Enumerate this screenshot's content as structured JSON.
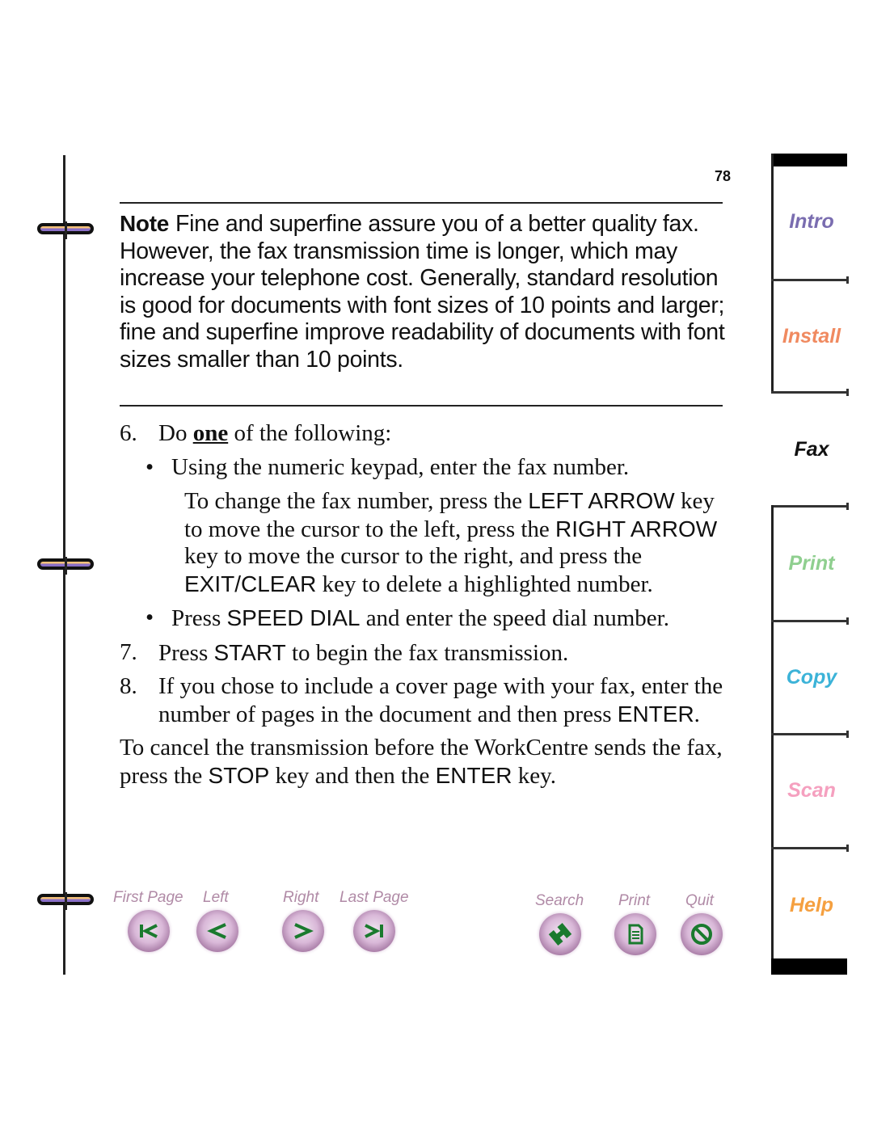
{
  "page_number": "78",
  "note": {
    "label": "Note",
    "text": "Fine and superfine assure you of a better quality fax. However, the fax transmission time is longer, which may increase your telephone cost. Generally, standard resolution is good for documents with font sizes of 10 points and larger; fine and superfine improve readability of documents with font sizes smaller than 10 points."
  },
  "steps": {
    "s6": {
      "num": "6.",
      "pre": "Do ",
      "emph": "one",
      "post": " of the following:"
    },
    "b1": {
      "text": "Using the numeric keypad, enter the fax number."
    },
    "b1sub": {
      "t1": "To change the fax number, press the ",
      "k1": "LEFT ARROW",
      "t2": " key to move the cursor to the left, press the ",
      "k2": "RIGHT ARROW",
      "t3": " key to move the cursor to the right, and press the ",
      "k3": "EXIT/CLEAR",
      "t4": " key to delete a highlighted number."
    },
    "b2": {
      "t1": "Press ",
      "k1": "SPEED DIAL",
      "t2": " and enter the speed dial number."
    },
    "s7": {
      "num": "7.",
      "t1": "Press ",
      "k1": "START",
      "t2": " to begin the fax transmission."
    },
    "s8": {
      "num": "8.",
      "t1": "If you chose to include a cover page with your fax, enter the number of pages in the document and then press ",
      "k1": "ENTER",
      "t2": "."
    },
    "cancel": {
      "t1": "To cancel the transmission before the WorkCentre sends the fax, press the ",
      "k1": "STOP",
      "t2": " key and then the ",
      "k2": "ENTER",
      "t3": " key."
    }
  },
  "bullet_glyph": "•",
  "tabs": [
    {
      "label": "Intro",
      "color": "#7a6db0"
    },
    {
      "label": "Install",
      "color": "#f08a60"
    },
    {
      "label": "Fax",
      "color": "#111111"
    },
    {
      "label": "Print",
      "color": "#8fcf8f"
    },
    {
      "label": "Copy",
      "color": "#3cb3d8"
    },
    {
      "label": "Scan",
      "color": "#f5a0bf"
    },
    {
      "label": "Help",
      "color": "#f5a040"
    }
  ],
  "nav": {
    "first_page": {
      "label": "First Page",
      "icon": "first-page-icon"
    },
    "left": {
      "label": "Left",
      "icon": "arrow-left-icon"
    },
    "right": {
      "label": "Right",
      "icon": "arrow-right-icon"
    },
    "last_page": {
      "label": "Last Page",
      "icon": "last-page-icon"
    },
    "search": {
      "label": "Search",
      "icon": "binoculars-icon"
    },
    "print": {
      "label": "Print",
      "icon": "document-icon"
    },
    "quit": {
      "label": "Quit",
      "icon": "no-entry-icon"
    }
  },
  "colors": {
    "nav_label": "#b08aa6",
    "nav_glyph": "#1a7a2e"
  }
}
